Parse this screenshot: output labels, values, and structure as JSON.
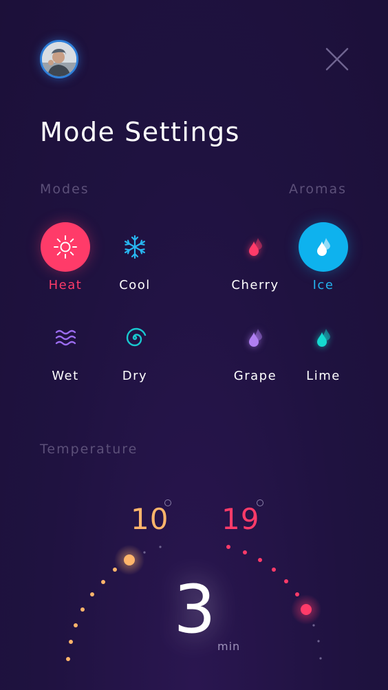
{
  "header": {
    "avatar_icon": "user-avatar-photo",
    "close_icon": "close-x-icon"
  },
  "title": "Mode Settings",
  "modes": {
    "label": "Modes",
    "items": [
      {
        "label": "Heat",
        "icon": "sun-icon",
        "selected": true,
        "color": "#ff3b69"
      },
      {
        "label": "Cool",
        "icon": "snowflake-icon",
        "selected": false,
        "color": "#28b6f0"
      },
      {
        "label": "Wet",
        "icon": "waves-icon",
        "selected": false,
        "color": "#9b6cf0"
      },
      {
        "label": "Dry",
        "icon": "spiral-icon",
        "selected": false,
        "color": "#19c9cf"
      }
    ]
  },
  "aromas": {
    "label": "Aromas",
    "items": [
      {
        "label": "Cherry",
        "icon": "droplet-icon",
        "selected": false,
        "color": "#ff3b69"
      },
      {
        "label": "Ice",
        "icon": "droplet-icon",
        "selected": true,
        "color": "#0eb2ee"
      },
      {
        "label": "Grape",
        "icon": "droplet-icon",
        "selected": false,
        "color": "#b07ff2"
      },
      {
        "label": "Lime",
        "icon": "droplet-icon",
        "selected": false,
        "color": "#15d9d0"
      }
    ]
  },
  "temperature": {
    "label": "Temperature",
    "low": "10",
    "high": "19",
    "low_color": "#ffb56b",
    "high_color": "#ff3b69",
    "duration": "3",
    "duration_unit": "min"
  }
}
